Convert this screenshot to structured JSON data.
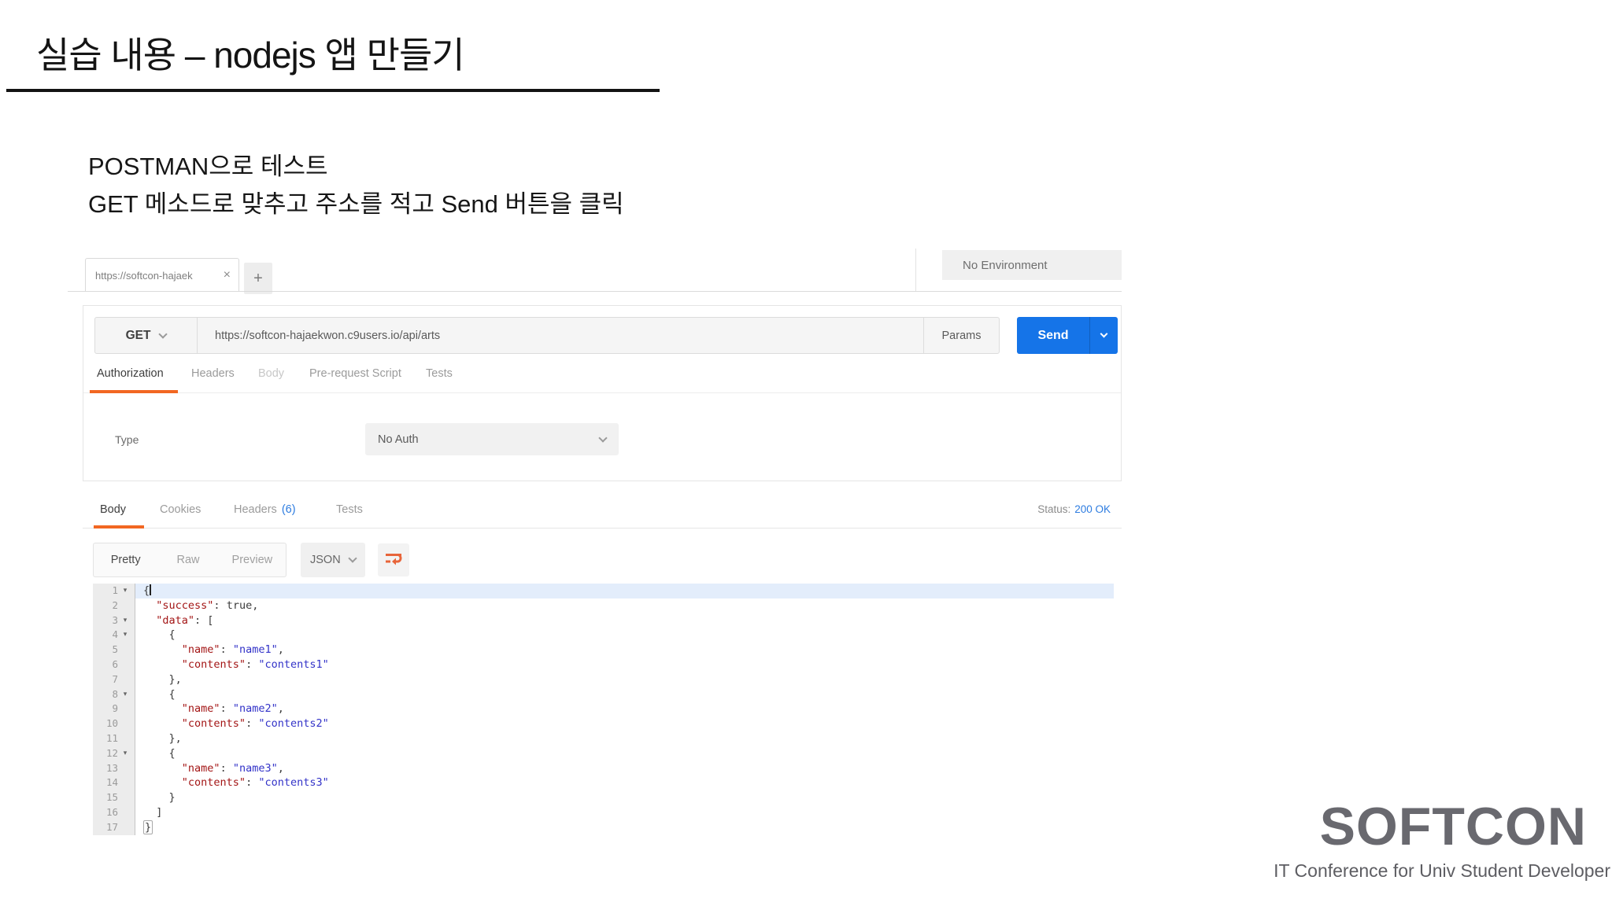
{
  "colors": {
    "accent_orange": "#f26722",
    "send_blue": "#1574e8",
    "link_blue": "#2d7ce0",
    "json_key": "#a31515",
    "json_string": "#3232c8"
  },
  "slide": {
    "title": "실습 내용 – nodejs 앱 만들기",
    "body_line1": "POSTMAN으로 테스트",
    "body_line2": "GET 메소드로 맞추고 주소를 적고 Send 버튼을 클릭"
  },
  "postman": {
    "tabbar": {
      "tab_title": "https://softcon-hajaek",
      "close_glyph": "×",
      "new_tab_glyph": "+"
    },
    "environment": {
      "selected": "No Environment"
    },
    "request": {
      "method": "GET",
      "url": "https://softcon-hajaekwon.c9users.io/api/arts",
      "params_label": "Params",
      "send_label": "Send",
      "tabs": [
        {
          "label": "Authorization"
        },
        {
          "label": "Headers"
        },
        {
          "label": "Body"
        },
        {
          "label": "Pre-request Script"
        },
        {
          "label": "Tests"
        }
      ],
      "type_label": "Type",
      "auth_type": "No Auth"
    },
    "response": {
      "tabs": [
        {
          "label": "Body"
        },
        {
          "label": "Cookies"
        },
        {
          "label": "Headers",
          "count": "(6)"
        },
        {
          "label": "Tests"
        }
      ],
      "status_label": "Status:",
      "status_value": "200 OK",
      "views": [
        {
          "label": "Pretty"
        },
        {
          "label": "Raw"
        },
        {
          "label": "Preview"
        }
      ],
      "format_selected": "JSON",
      "code": {
        "fold_glyph": "▾",
        "lines": [
          {
            "n": 1,
            "fold": true,
            "hl": true,
            "cursor": true,
            "seg": [
              [
                "p",
                "{"
              ]
            ]
          },
          {
            "n": 2,
            "seg": [
              [
                "p",
                "  "
              ],
              [
                "k",
                "\"success\""
              ],
              [
                "p",
                ": "
              ],
              [
                "b",
                "true"
              ],
              [
                "p",
                ","
              ]
            ]
          },
          {
            "n": 3,
            "fold": true,
            "seg": [
              [
                "p",
                "  "
              ],
              [
                "k",
                "\"data\""
              ],
              [
                "p",
                ": ["
              ]
            ]
          },
          {
            "n": 4,
            "fold": true,
            "seg": [
              [
                "p",
                "    {"
              ]
            ]
          },
          {
            "n": 5,
            "seg": [
              [
                "p",
                "      "
              ],
              [
                "k",
                "\"name\""
              ],
              [
                "p",
                ": "
              ],
              [
                "s",
                "\"name1\""
              ],
              [
                "p",
                ","
              ]
            ]
          },
          {
            "n": 6,
            "seg": [
              [
                "p",
                "      "
              ],
              [
                "k",
                "\"contents\""
              ],
              [
                "p",
                ": "
              ],
              [
                "s",
                "\"contents1\""
              ]
            ]
          },
          {
            "n": 7,
            "seg": [
              [
                "p",
                "    },"
              ]
            ]
          },
          {
            "n": 8,
            "fold": true,
            "seg": [
              [
                "p",
                "    {"
              ]
            ]
          },
          {
            "n": 9,
            "seg": [
              [
                "p",
                "      "
              ],
              [
                "k",
                "\"name\""
              ],
              [
                "p",
                ": "
              ],
              [
                "s",
                "\"name2\""
              ],
              [
                "p",
                ","
              ]
            ]
          },
          {
            "n": 10,
            "seg": [
              [
                "p",
                "      "
              ],
              [
                "k",
                "\"contents\""
              ],
              [
                "p",
                ": "
              ],
              [
                "s",
                "\"contents2\""
              ]
            ]
          },
          {
            "n": 11,
            "seg": [
              [
                "p",
                "    },"
              ]
            ]
          },
          {
            "n": 12,
            "fold": true,
            "seg": [
              [
                "p",
                "    {"
              ]
            ]
          },
          {
            "n": 13,
            "seg": [
              [
                "p",
                "      "
              ],
              [
                "k",
                "\"name\""
              ],
              [
                "p",
                ": "
              ],
              [
                "s",
                "\"name3\""
              ],
              [
                "p",
                ","
              ]
            ]
          },
          {
            "n": 14,
            "seg": [
              [
                "p",
                "      "
              ],
              [
                "k",
                "\"contents\""
              ],
              [
                "p",
                ": "
              ],
              [
                "s",
                "\"contents3\""
              ]
            ]
          },
          {
            "n": 15,
            "seg": [
              [
                "p",
                "    }"
              ]
            ]
          },
          {
            "n": 16,
            "seg": [
              [
                "p",
                "  ]"
              ]
            ]
          },
          {
            "n": 17,
            "seg": [
              [
                "m",
                "}"
              ]
            ]
          }
        ]
      }
    }
  },
  "footer": {
    "logo_text": "SOFTCON",
    "tagline": "IT Conference for Univ Student Developer"
  }
}
